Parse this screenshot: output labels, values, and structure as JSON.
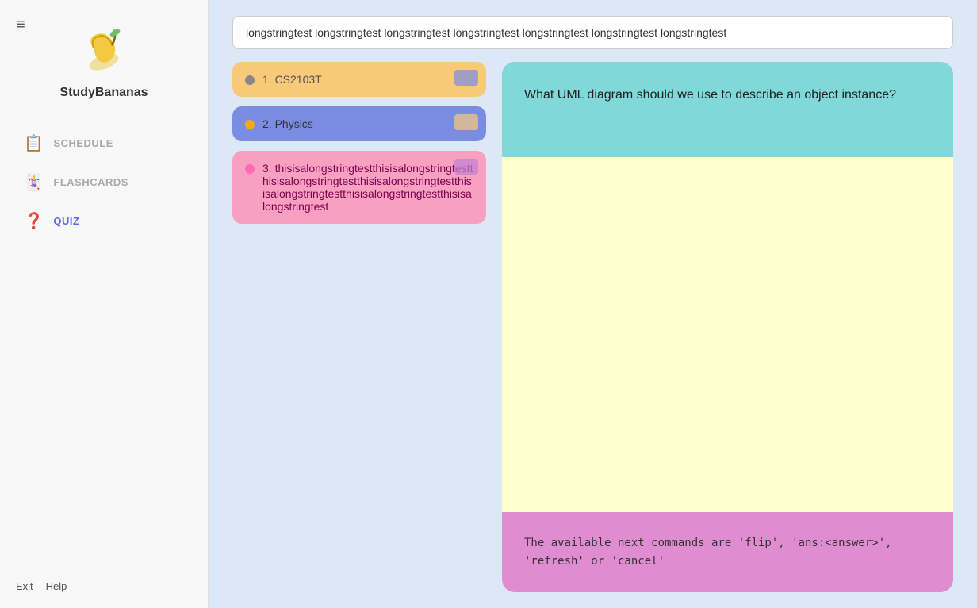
{
  "sidebar": {
    "menu_icon": "≡",
    "app_title": "StudyBananas",
    "nav_items": [
      {
        "id": "schedule",
        "label": "SCHEDULE",
        "icon": "📋",
        "active": false
      },
      {
        "id": "flashcards",
        "label": "FLASHCARDS",
        "icon": "🃏",
        "active": false
      },
      {
        "id": "quiz",
        "label": "QUIZ",
        "icon": "❓",
        "active": true
      }
    ],
    "footer": {
      "exit_label": "Exit",
      "help_label": "Help"
    }
  },
  "main": {
    "search_value": "longstringtest longstringtest longstringtest longstringtest longstringtest longstringtest longstringtest",
    "decks": [
      {
        "id": "cs2103t",
        "label": "1. CS2103T",
        "style": "cs"
      },
      {
        "id": "physics",
        "label": "2. Physics",
        "style": "physics"
      },
      {
        "id": "longstring",
        "label": "3. thisisalongstringtestthisisalongstringtestthisisalongstringtestthisisalongstringtestthisisalongstringtestthisisalongstringtestthisisalongstringtest",
        "style": "long"
      }
    ],
    "flashcard": {
      "question": "What UML diagram should we use to describe an object instance?",
      "answer": "",
      "commands": "The available next commands are 'flip', 'ans:<answer>', 'refresh' or 'cancel'"
    }
  }
}
